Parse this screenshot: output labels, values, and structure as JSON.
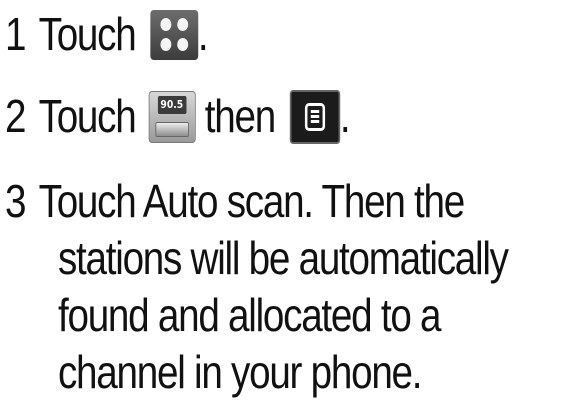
{
  "steps": [
    {
      "number": "1",
      "text_before": "Touch",
      "icon": "grid-icon",
      "text_after": "."
    },
    {
      "number": "2",
      "text_before": "Touch",
      "icon": "fm-radio-icon",
      "icon_label": "90.5",
      "text_middle": "then",
      "icon2": "menu-icon",
      "text_after": "."
    },
    {
      "number": "3",
      "lines": [
        "Touch Auto scan. Then the",
        "stations will be automatically",
        "found and allocated to a",
        "channel in your phone."
      ]
    }
  ],
  "colors": {
    "text": "#111111",
    "grid_icon_bg": "#555555",
    "menu_icon_bg": "#1b1b1b"
  }
}
